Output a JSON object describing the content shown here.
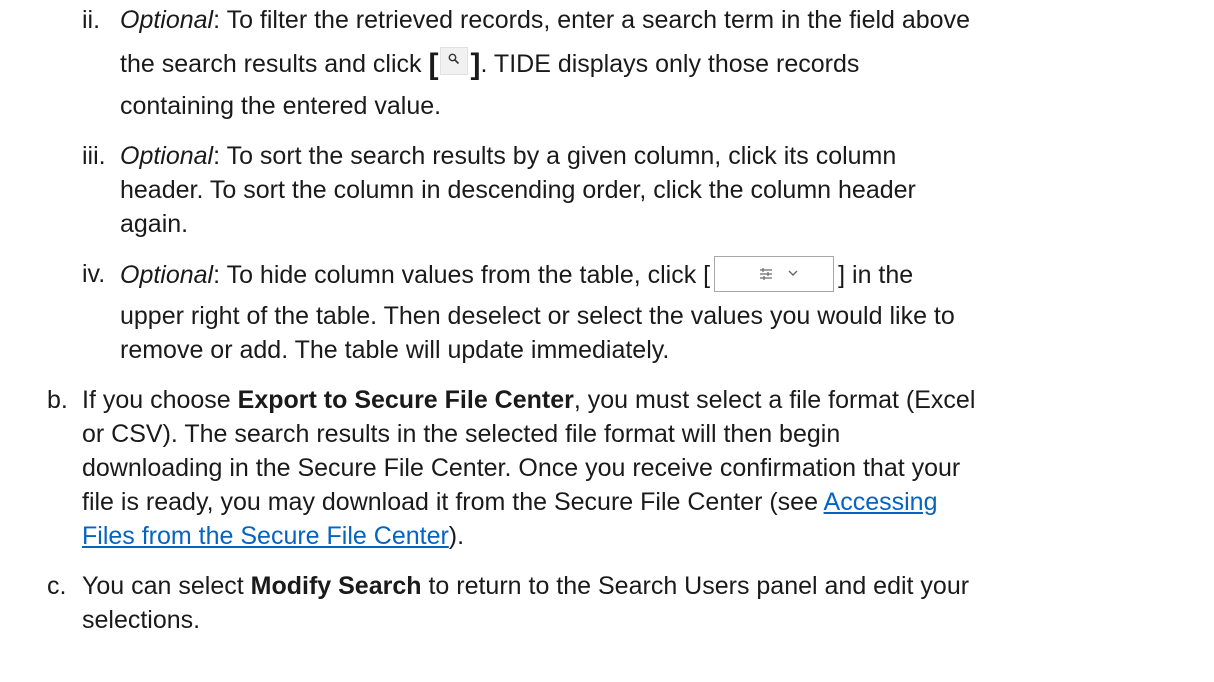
{
  "steps": {
    "ii": {
      "marker": "ii.",
      "optional": "Optional",
      "text_a": ": To filter the retrieved records, enter a search term in the field above",
      "text_b": "the search results and click ",
      "bracket_open": "[",
      "bracket_close": "]",
      "text_c": ". TIDE displays only those records",
      "text_d": "containing the entered value.",
      "icon": "search-icon"
    },
    "iii": {
      "marker": "iii.",
      "optional": "Optional",
      "text_a": ": To sort the search results by a given column, click its column",
      "text_b": "header. To sort the column in descending order, click the column header",
      "text_c": "again."
    },
    "iv": {
      "marker": "iv.",
      "optional": "Optional",
      "text_a": ": To hide column values from the table, click [",
      "text_b": "] in the",
      "text_c": "upper right of the table. Then deselect or select the values you would like to",
      "text_d": "remove or add. The table will update immediately.",
      "icons": [
        "tune-icon",
        "chevron-down-icon"
      ]
    },
    "b": {
      "marker": "b.",
      "text_a": "If you choose ",
      "bold": "Export to Secure File Center",
      "text_b": ", you must select a file format (Excel",
      "text_c": "or CSV). The search results in the selected file format will then begin",
      "text_d": "downloading in the Secure File Center. Once you receive confirmation that your",
      "text_e": "file is ready, you may download it from the Secure File Center (see ",
      "link_a": "Accessing",
      "link_b": "Files from the Secure File Center",
      "text_f": ")."
    },
    "c": {
      "marker": "c.",
      "text_a": "You can select ",
      "bold": "Modify Search",
      "text_b": " to return to the Search Users panel and edit your",
      "text_c": "selections."
    }
  },
  "colors": {
    "link": "#0563c1",
    "text": "#1a1a1a"
  }
}
